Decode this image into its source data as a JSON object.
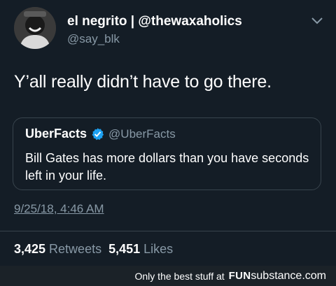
{
  "author": {
    "name": "el negrito | @thewaxaholics",
    "handle": "@say_blk",
    "avatar": "avatar-photo"
  },
  "tweet": {
    "text": "Y’all really didn’t have to go there.",
    "timestamp": "9/25/18, 4:46 AM"
  },
  "quoted": {
    "name": "UberFacts",
    "handle": "@UberFacts",
    "verified": true,
    "text": "Bill Gates has more dollars than you have seconds left in your life."
  },
  "stats": {
    "retweets_count": "3,425",
    "retweets_label": "Retweets",
    "likes_count": "5,451",
    "likes_label": "Likes"
  },
  "footer": {
    "tagline": "Only the best stuff at",
    "brand_fun": "FUN",
    "brand_rest": "substance.com"
  },
  "colors": {
    "background": "#141d26",
    "secondary_text": "#8899a6",
    "border": "#38444d",
    "verified_blue": "#1da1f2"
  }
}
